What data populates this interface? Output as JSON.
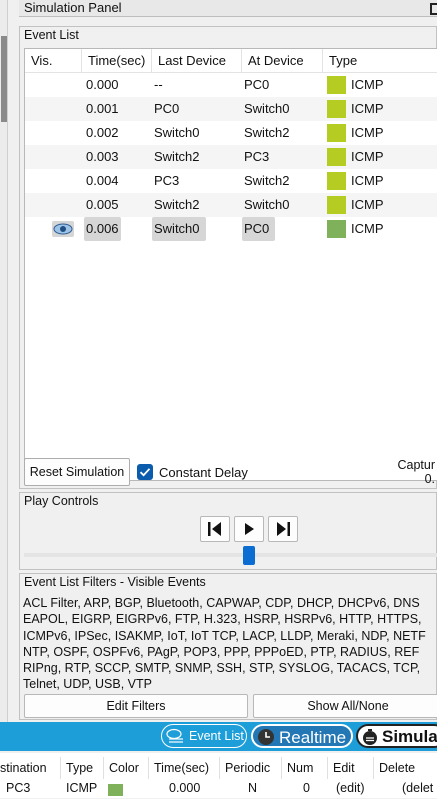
{
  "panel": {
    "title": "Simulation Panel"
  },
  "event_list": {
    "label": "Event List",
    "columns": [
      "Vis.",
      "Time(sec)",
      "Last Device",
      "At Device",
      "Type"
    ],
    "rows": [
      {
        "time": "0.000",
        "last": "--",
        "at": "PC0",
        "type": "ICMP",
        "color": "#b5cc22"
      },
      {
        "time": "0.001",
        "last": "PC0",
        "at": "Switch0",
        "type": "ICMP",
        "color": "#b5cc22"
      },
      {
        "time": "0.002",
        "last": "Switch0",
        "at": "Switch2",
        "type": "ICMP",
        "color": "#b5cc22"
      },
      {
        "time": "0.003",
        "last": "Switch2",
        "at": "PC3",
        "type": "ICMP",
        "color": "#b5cc22"
      },
      {
        "time": "0.004",
        "last": "PC3",
        "at": "Switch2",
        "type": "ICMP",
        "color": "#b5cc22"
      },
      {
        "time": "0.005",
        "last": "Switch2",
        "at": "Switch0",
        "type": "ICMP",
        "color": "#b5cc22"
      },
      {
        "time": "0.006",
        "last": "Switch0",
        "at": "PC0",
        "type": "ICMP",
        "color": "#7fb05a",
        "current": true,
        "vis_icon": "eye-icon"
      }
    ],
    "reset_label": "Reset Simulation",
    "constant_delay_label": "Constant Delay",
    "constant_delay_checked": true,
    "capture_label": "Captur",
    "capture_value": "0."
  },
  "play_controls": {
    "label": "Play Controls",
    "buttons": [
      "step-back-icon",
      "play-icon",
      "step-forward-icon"
    ],
    "slider_fraction": 0.55
  },
  "filters": {
    "label": "Event List Filters - Visible Events",
    "lines": [
      "ACL Filter, ARP, BGP, Bluetooth, CAPWAP, CDP, DHCP, DHCPv6, DNS",
      "EAPOL, EIGRP, EIGRPv6, FTP, H.323, HSRP, HSRPv6, HTTP, HTTPS,",
      "ICMPv6, IPSec, ISAKMP, IoT, IoT TCP, LACP, LLDP, Meraki, NDP, NETF",
      "NTP, OSPF, OSPFv6, PAgP, POP3, PPP, PPPoED, PTP, RADIUS, REF",
      "RIPng, RTP, SCCP, SMTP, SNMP, SSH, STP, SYSLOG, TACACS, TCP,",
      "Telnet, UDP, USB, VTP"
    ],
    "edit_label": "Edit Filters",
    "show_all_label": "Show All/None"
  },
  "mode_tabs": {
    "event_list": "Event List",
    "realtime": "Realtime",
    "simulation": "Simula"
  },
  "pdu_table": {
    "columns": [
      "stination",
      "Type",
      "Color",
      "Time(sec)",
      "Periodic",
      "Num",
      "Edit",
      "Delete"
    ],
    "row": {
      "destination": "PC3",
      "type": "ICMP",
      "color": "#7fb05a",
      "time": "0.000",
      "periodic": "N",
      "num": "0",
      "edit": "(edit)",
      "delete": "(delet"
    }
  },
  "colors": {
    "accent": "#1e9ed9",
    "checkbox": "#0b5cad",
    "slider": "#0b6dd1"
  }
}
